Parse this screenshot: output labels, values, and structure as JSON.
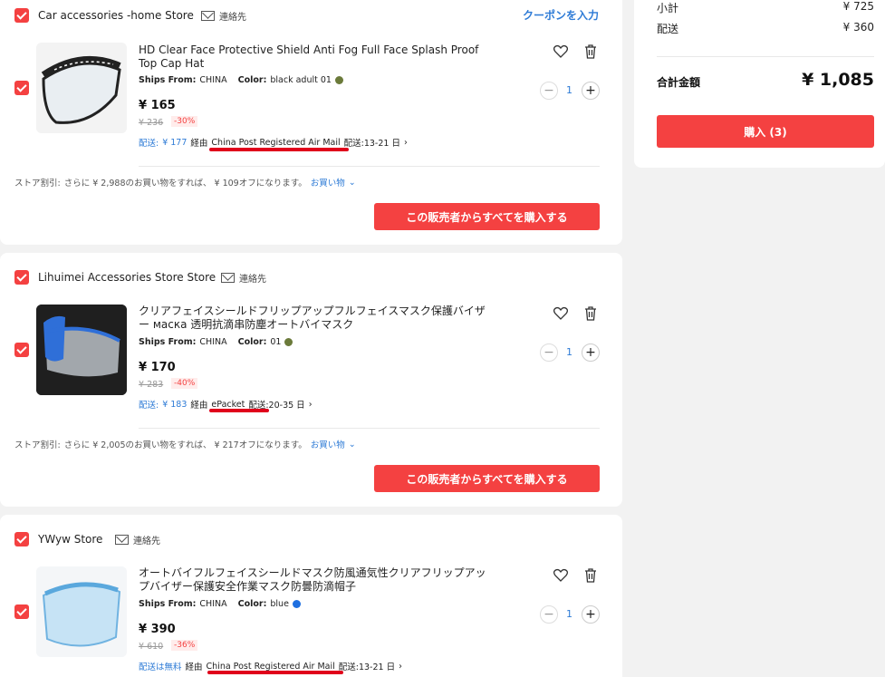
{
  "summary": {
    "subtotal_label": "小計",
    "subtotal_value": "¥ 725",
    "shipping_label": "配送",
    "shipping_value": "¥ 360",
    "total_label": "合計金額",
    "total_value": "¥ 1,085",
    "purchase_label": "購入 (3)"
  },
  "common": {
    "contact_label": "連絡先",
    "ships_from_label": "Ships From:",
    "ships_from_value": "CHINA",
    "color_label": "Color:",
    "discount_prefix": "ストア割引:",
    "shop_more_label": "お買い物",
    "buy_all_label": "この販売者からすべてを購入する",
    "coupon_label": "クーポンを入力"
  },
  "stores": [
    {
      "name": "Car accessories -home Store",
      "item": {
        "title": "HD Clear Face Protective Shield Anti Fog Full Face Splash Proof Top Cap Hat",
        "color": "black adult 01",
        "color_hex": "#6b7a3a",
        "price": "¥ 165",
        "old_price": "¥ 236",
        "discount": "-30%",
        "ship_prefix": "配送:",
        "ship_cost": "¥ 177",
        "via": "経由",
        "carrier": "China Post Registered Air Mail",
        "delivery": "配送:13-21 日",
        "qty": "1"
      },
      "discount_text": "さらに ¥ 2,988のお買い物をすれば、 ¥ 109オフになります。"
    },
    {
      "name": "Lihuimei Accessories Store Store",
      "item": {
        "title": "クリアフェイスシールドフリップアップフルフェイスマスク保護バイザー маска 透明抗滴串防塵オートバイマスク",
        "color": "01",
        "color_hex": "#6b7a3a",
        "price": "¥ 170",
        "old_price": "¥ 283",
        "discount": "-40%",
        "ship_prefix": "配送:",
        "ship_cost": "¥ 183",
        "via": "経由",
        "carrier": "ePacket",
        "delivery": "配送:20-35 日",
        "qty": "1"
      },
      "discount_text": "さらに ¥ 2,005のお買い物をすれば、 ¥ 217オフになります。"
    },
    {
      "name": "YWyw Store",
      "item": {
        "title": "オートバイフルフェイスシールドマスク防風通気性クリアフリップアップバイザー保護安全作業マスク防曇防滴帽子",
        "color": "blue",
        "color_hex": "#1e6fe0",
        "price": "¥ 390",
        "old_price": "¥ 610",
        "discount": "-36%",
        "ship_free": "配送は無料",
        "via": "経由",
        "carrier": "China Post Registered Air Mail",
        "delivery": "配送:13-21 日",
        "qty": "1"
      }
    }
  ]
}
